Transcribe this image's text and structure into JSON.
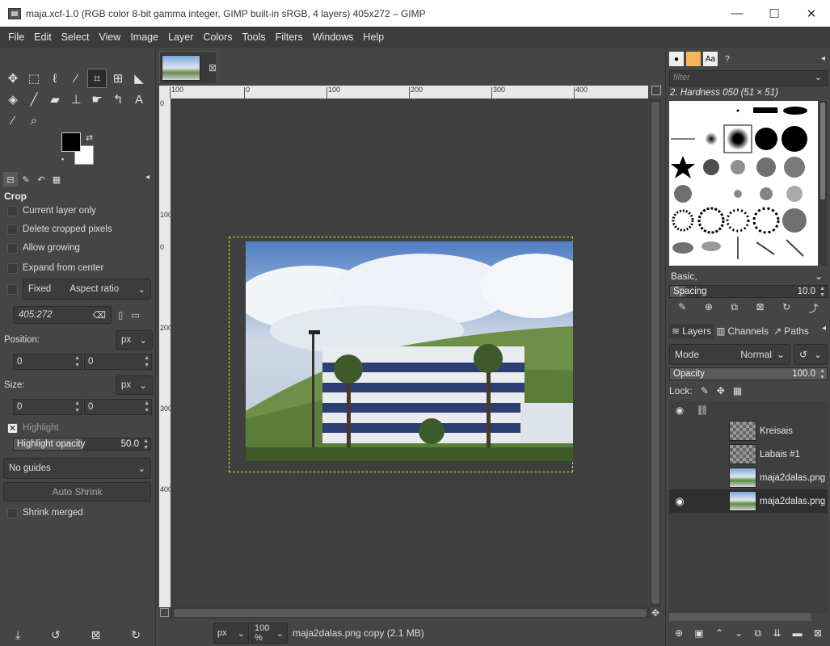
{
  "window": {
    "title": "maja.xcf-1.0 (RGB color 8-bit gamma integer, GIMP built-in sRGB, 4 layers) 405x272 – GIMP",
    "minimize": "—",
    "maximize": "☐",
    "close": "✕"
  },
  "menu": [
    "File",
    "Edit",
    "Select",
    "View",
    "Image",
    "Layer",
    "Colors",
    "Tools",
    "Filters",
    "Windows",
    "Help"
  ],
  "tool_options": {
    "title": "Crop",
    "current_layer_only": "Current layer only",
    "delete_cropped_pixels": "Delete cropped pixels",
    "allow_growing": "Allow growing",
    "expand_from_center": "Expand from center",
    "fixed_label": "Fixed",
    "fixed_mode": "Aspect ratio",
    "aspect_value": "405:272",
    "position_label": "Position:",
    "position_unit": "px",
    "position_x": "0",
    "position_y": "0",
    "size_label": "Size:",
    "size_unit": "px",
    "size_w": "0",
    "size_h": "0",
    "highlight_label": "Highlight",
    "highlight_opacity_label": "Highlight opacity",
    "highlight_opacity_value": "50.0",
    "highlight_opacity_level": 0.5,
    "guides": "No guides",
    "auto_shrink": "Auto Shrink",
    "shrink_merged": "Shrink merged"
  },
  "rulers": {
    "h_labels": [
      "100",
      "0",
      "100",
      "200",
      "300",
      "400"
    ],
    "v_labels": [
      "0",
      "100",
      "0",
      "200",
      "300",
      "400"
    ]
  },
  "statusbar": {
    "unit": "px",
    "zoom": "100 %",
    "info": "maja2dalas.png copy (2.1 MB)"
  },
  "brushes": {
    "filter_placeholder": "filter",
    "selected_brush": "2. Hardness 050 (51 × 51)",
    "preset": "Basic,",
    "spacing_label": "Spacing",
    "spacing_value": "10.0",
    "spacing_level": 0.1
  },
  "layers_dock": {
    "tabs": [
      "Layers",
      "Channels",
      "Paths"
    ],
    "mode_label": "Mode",
    "mode_value": "Normal",
    "opacity_label": "Opacity",
    "opacity_value": "100.0",
    "opacity_level": 1.0,
    "lock_label": "Lock:",
    "layers": [
      {
        "name": "Kreisais",
        "visible": false,
        "thumb": "checker"
      },
      {
        "name": "Labais #1",
        "visible": false,
        "thumb": "checker"
      },
      {
        "name": "maja2dalas.png",
        "visible": false,
        "thumb": "photo"
      },
      {
        "name": "maja2dalas.png",
        "visible": true,
        "thumb": "photo"
      }
    ]
  },
  "colors": {
    "background": "#454545",
    "boundary": "#d4d41a",
    "foreground_swatch": "#000000",
    "background_swatch": "#ffffff"
  }
}
